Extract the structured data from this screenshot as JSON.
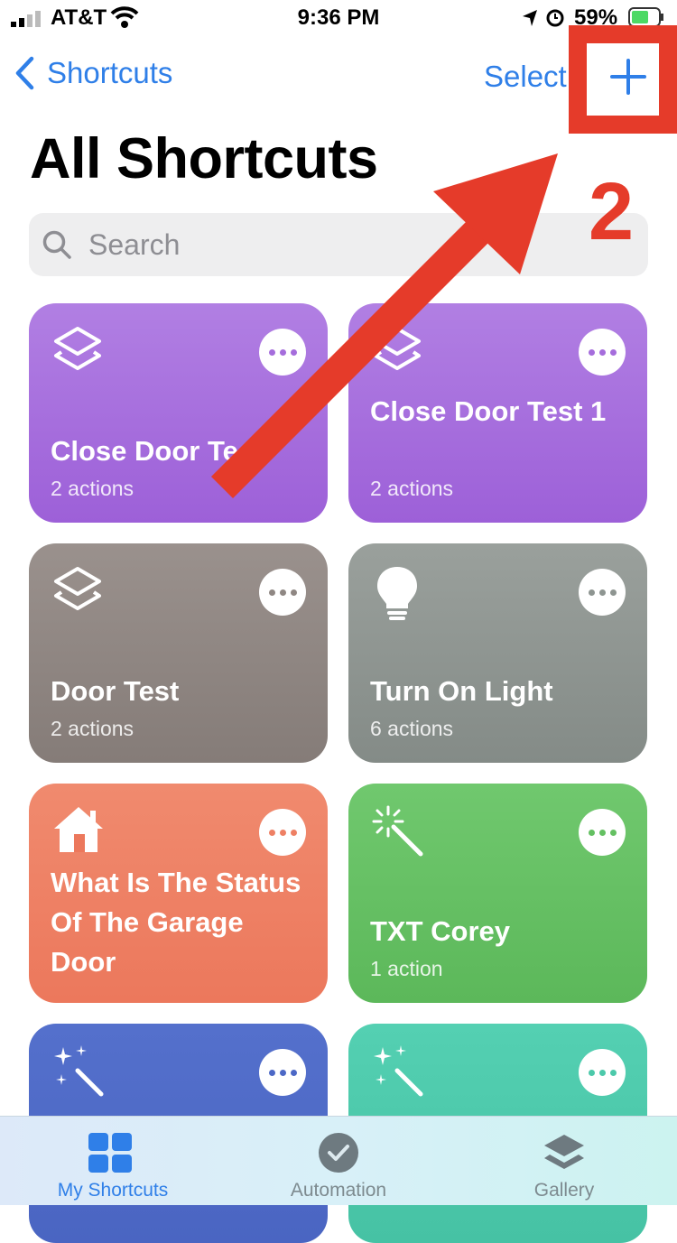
{
  "status": {
    "carrier": "AT&T",
    "time": "9:36 PM",
    "battery": "59%"
  },
  "nav": {
    "back_label": "Shortcuts",
    "select_label": "Select"
  },
  "page": {
    "title": "All Shortcuts"
  },
  "search": {
    "placeholder": "Search"
  },
  "annotation": {
    "step": "2"
  },
  "cards": [
    {
      "name": "Close Door Test",
      "count": "2 actions",
      "color": "#a56ddc",
      "icon": "stack-icon"
    },
    {
      "name": "Close Door Test 1",
      "count": "2 actions",
      "color": "#a56ddc",
      "icon": "stack-icon"
    },
    {
      "name": "Door Test",
      "count": "2 actions",
      "color": "#8f8783",
      "icon": "stack-icon"
    },
    {
      "name": "Turn On Light",
      "count": "6 actions",
      "color": "#8e9591",
      "icon": "lightbulb-icon"
    },
    {
      "name": "What Is The Status Of The Garage Door",
      "count": "",
      "color": "#ee8064",
      "icon": "house-icon"
    },
    {
      "name": "TXT Corey",
      "count": "1 action",
      "color": "#64c062",
      "icon": "magic-wand-icon"
    },
    {
      "name": "",
      "count": "",
      "color": "#4c68c6",
      "icon": "sparkles-wand-icon"
    },
    {
      "name": "",
      "count": "",
      "color": "#4cc9aa",
      "icon": "sparkles-wand-icon"
    }
  ],
  "tabs": [
    {
      "label": "My Shortcuts",
      "active": true
    },
    {
      "label": "Automation",
      "active": false
    },
    {
      "label": "Gallery",
      "active": false
    }
  ],
  "colors": {
    "accent": "#2f7fe8",
    "highlight": "#e53b2a"
  }
}
